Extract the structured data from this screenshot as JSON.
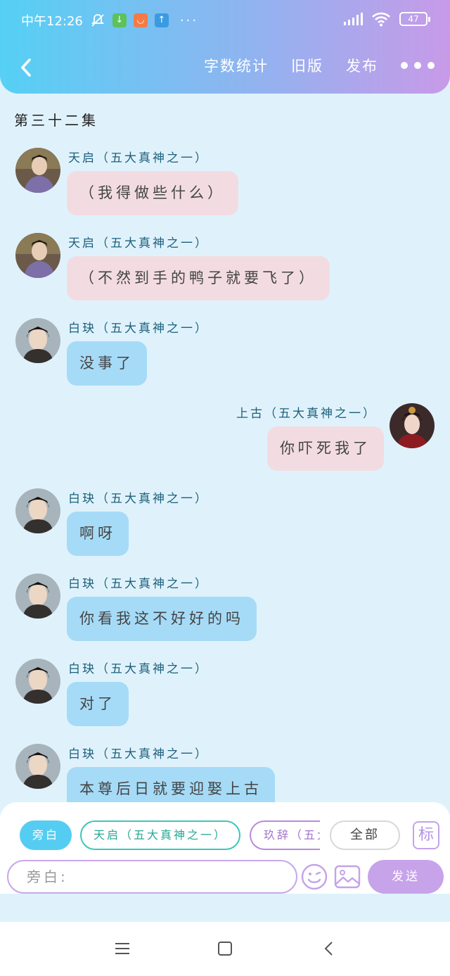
{
  "status_bar": {
    "time": "中午12:26",
    "battery": "47",
    "icons": [
      "mute-bell-icon",
      "download-icon",
      "shopping-icon",
      "upload-icon"
    ],
    "more": "···"
  },
  "nav": {
    "back_icon": "chevron-left-icon",
    "word_count": "字数统计",
    "old_version": "旧版",
    "publish": "发布",
    "more_icon": "more-dots-icon"
  },
  "episode_title": "第三十二集",
  "messages": [
    {
      "sender": "天启（五大真神之一）",
      "text": "（我得做些什么）",
      "side": "left",
      "bubble": "pink",
      "avatar": "tianqi"
    },
    {
      "sender": "天启（五大真神之一）",
      "text": "（不然到手的鸭子就要飞了）",
      "side": "left",
      "bubble": "pink",
      "avatar": "tianqi"
    },
    {
      "sender": "白玦（五大真神之一）",
      "text": "没事了",
      "side": "left",
      "bubble": "blue",
      "avatar": "baijue"
    },
    {
      "sender": "上古（五大真神之一）",
      "text": "你吓死我了",
      "side": "right",
      "bubble": "pink",
      "avatar": "shanggu"
    },
    {
      "sender": "白玦（五大真神之一）",
      "text": "啊呀",
      "side": "left",
      "bubble": "blue",
      "avatar": "baijue"
    },
    {
      "sender": "白玦（五大真神之一）",
      "text": "你看我这不好好的吗",
      "side": "left",
      "bubble": "blue",
      "avatar": "baijue"
    },
    {
      "sender": "白玦（五大真神之一）",
      "text": "对了",
      "side": "left",
      "bubble": "blue",
      "avatar": "baijue"
    },
    {
      "sender": "白玦（五大真神之一）",
      "text": "本尊后日就要迎娶上古",
      "side": "left",
      "bubble": "blue",
      "avatar": "baijue"
    }
  ],
  "roles": {
    "narration": "旁白",
    "tianqi": "天启（五大真神之一）",
    "jiuci": "玖辞（五大",
    "all": "全部",
    "mark": "标"
  },
  "input": {
    "placeholder": "旁白:",
    "emoji_icon": "smiley-icon",
    "image_icon": "image-icon",
    "send": "发送"
  },
  "colors": {
    "header_start": "#55d0f4",
    "header_end": "#c89ae8",
    "bubble_pink": "#f2dce2",
    "bubble_blue": "#a6dbf7",
    "accent_purple": "#c7a3ea"
  }
}
